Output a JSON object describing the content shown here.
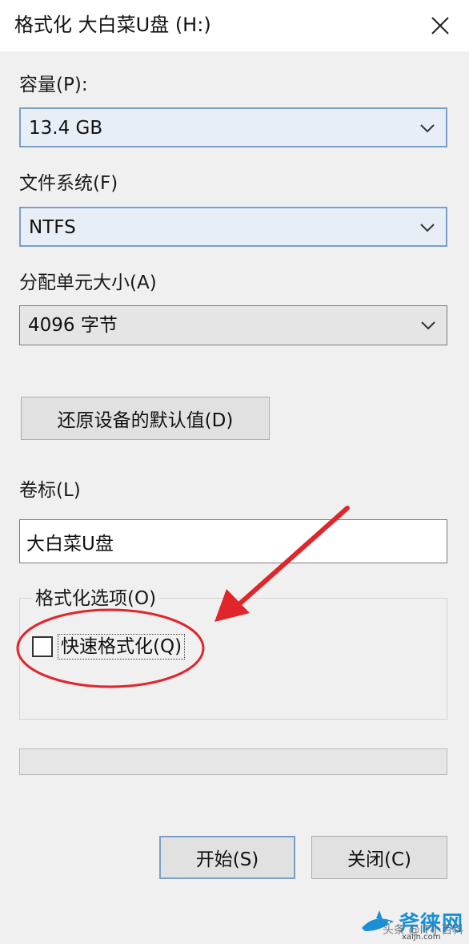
{
  "window": {
    "title": "格式化 大白菜U盘 (H:)",
    "close_icon": "close-icon"
  },
  "capacity": {
    "label": "容量(P):",
    "value": "13.4 GB"
  },
  "filesystem": {
    "label": "文件系统(F)",
    "value": "NTFS"
  },
  "allocation": {
    "label": "分配单元大小(A)",
    "value": "4096 字节"
  },
  "restore_button": {
    "label": "还原设备的默认值(D)"
  },
  "volume": {
    "label": "卷标(L)",
    "value": "大白菜U盘"
  },
  "options": {
    "legend": "格式化选项(O)",
    "quick_format_label": "快速格式化(Q)",
    "quick_format_checked": false
  },
  "progress": {
    "value": 0
  },
  "buttons": {
    "start": "开始(S)",
    "close": "关闭(C)"
  },
  "annotation": {
    "color": "#e0252b"
  },
  "watermark": {
    "brand": "斧徕网",
    "url": "xaijn.com",
    "credit": "头条 @IT小百科"
  }
}
